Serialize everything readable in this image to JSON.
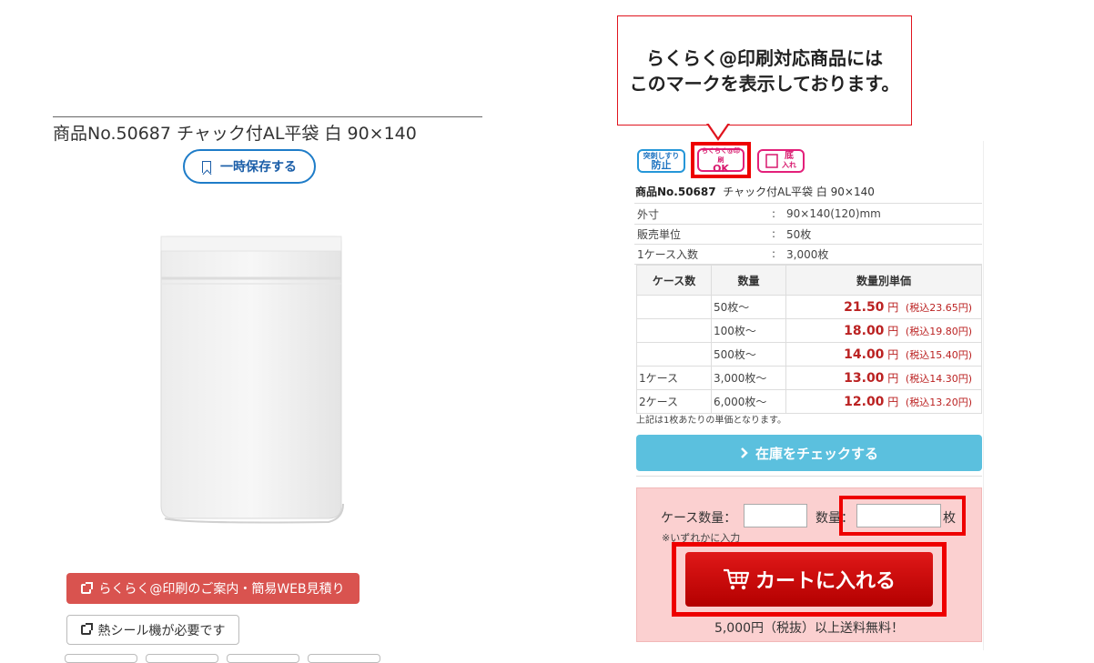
{
  "left": {
    "product_title": "商品No.50687 チャック付AL平袋 白 90×140",
    "save_button": "一時保存する",
    "raku_button": "らくらく@印刷のご案内・簡易WEB見積り",
    "heat_button": "熱シール機が必要です"
  },
  "callout": {
    "line1": "らくらく@印刷対応商品には",
    "line2": "このマークを表示しております。"
  },
  "badges": {
    "tamper_top": "突刺しすり",
    "tamper_bottom": "防止",
    "raku_top": "らくらく@印刷",
    "raku_bottom": "OK",
    "bottom_gusset_label": "底",
    "bottom_gusset_sub": "入れ"
  },
  "product": {
    "number": "商品No.50687",
    "name": "チャック付AL平袋 白 90×140",
    "specs": [
      {
        "label": "外寸",
        "value": "90×140(120)mm"
      },
      {
        "label": "販売単位",
        "value": "50枚"
      },
      {
        "label": "1ケース入数",
        "value": "3,000枚"
      }
    ],
    "separator": ":"
  },
  "price_table": {
    "headers": [
      "ケース数",
      "数量",
      "数量別単価"
    ],
    "rows": [
      {
        "case": "",
        "qty": "50枚～",
        "price": "21.50",
        "unit": "円",
        "tax": "(税込23.65円)"
      },
      {
        "case": "",
        "qty": "100枚～",
        "price": "18.00",
        "unit": "円",
        "tax": "(税込19.80円)"
      },
      {
        "case": "",
        "qty": "500枚～",
        "price": "14.00",
        "unit": "円",
        "tax": "(税込15.40円)"
      },
      {
        "case": "1ケース",
        "qty": "3,000枚～",
        "price": "13.00",
        "unit": "円",
        "tax": "(税込14.30円)"
      },
      {
        "case": "2ケース",
        "qty": "6,000枚～",
        "price": "12.00",
        "unit": "円",
        "tax": "(税込13.20円)"
      }
    ],
    "note": "上記は1枚あたりの単価となります。"
  },
  "stock_button": "在庫をチェックする",
  "order": {
    "case_label": "ケース数量：",
    "case_value": "",
    "qty_label": "数量：",
    "qty_value": "",
    "qty_unit": "枚",
    "either_note": "※いずれかに入力",
    "cart_button": "カートに入れる",
    "shipping": "5,000円（税抜）以上送料無料！"
  },
  "colors": {
    "accent_red": "#e00000",
    "cart_red": "#c80000",
    "stock_blue": "#5bc0de",
    "raku_button_red": "#d9534f",
    "save_blue": "#1e7cc8",
    "order_bg": "#fbd0d0"
  }
}
